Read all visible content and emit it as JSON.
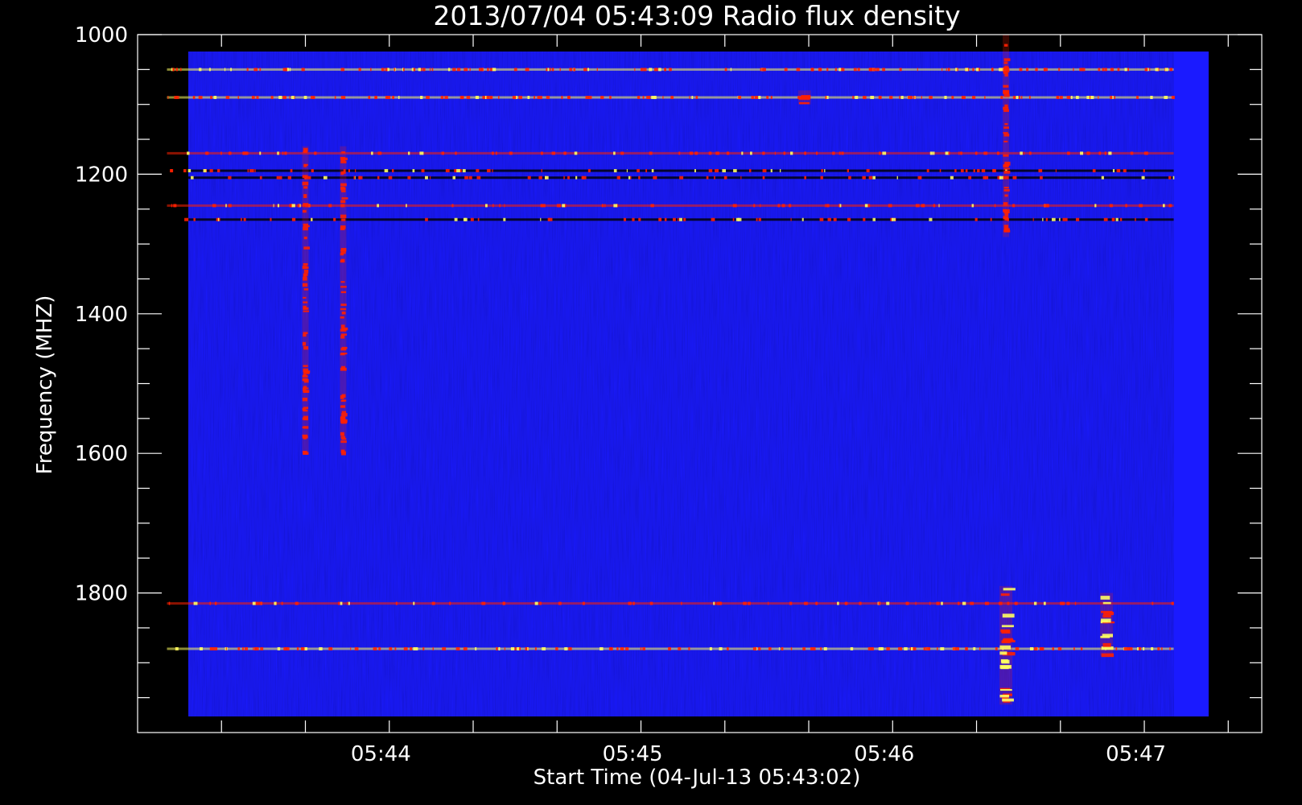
{
  "chart_data": {
    "type": "heatmap",
    "title": "2013/07/04 05:43:09 Radio flux density",
    "xlabel": "Start Time (04-Jul-13 05:43:02)",
    "ylabel": "Frequency (MHZ)",
    "y_axis_inverted": true,
    "ylim": [
      1000,
      2000
    ],
    "y_ticks": [
      1000,
      1200,
      1400,
      1600,
      1800
    ],
    "y_tick_labels": [
      "1000",
      "1200",
      "1400",
      "1600",
      "1800"
    ],
    "xlim": [
      "05:43:02",
      "05:47:30"
    ],
    "x_ticks": [
      "05:44",
      "05:45",
      "05:46",
      "05:47"
    ],
    "x_tick_labels": [
      "05:44",
      "05:45",
      "05:46",
      "05:47"
    ],
    "image_time_range": [
      "05:43:09",
      "05:47:09"
    ],
    "image_freq_range": [
      1000,
      1999
    ],
    "colormap": {
      "background": "#1a1aff",
      "low": "#000000",
      "mid": "#ff2000",
      "high": "#ffff60"
    },
    "features": [
      {
        "kind": "band",
        "freq": 1050,
        "intensity": "high"
      },
      {
        "kind": "band",
        "freq": 1090,
        "intensity": "high"
      },
      {
        "kind": "band",
        "freq": 1170,
        "intensity": "medium"
      },
      {
        "kind": "band",
        "freq": 1195,
        "intensity": "low"
      },
      {
        "kind": "band",
        "freq": 1205,
        "intensity": "low"
      },
      {
        "kind": "band",
        "freq": 1245,
        "intensity": "medium"
      },
      {
        "kind": "band",
        "freq": 1265,
        "intensity": "low"
      },
      {
        "kind": "band",
        "freq": 1815,
        "intensity": "medium"
      },
      {
        "kind": "band",
        "freq": 1880,
        "intensity": "high"
      },
      {
        "kind": "burst",
        "time": "05:46:29",
        "freq_range": [
          1790,
          1960
        ],
        "intensity": "high"
      },
      {
        "kind": "burst",
        "time": "05:46:29",
        "freq_range": [
          1000,
          1290
        ],
        "intensity": "medium"
      },
      {
        "kind": "burst",
        "time": "05:43:42",
        "freq_range": [
          1160,
          1600
        ],
        "intensity": "medium"
      },
      {
        "kind": "burst",
        "time": "05:43:51",
        "freq_range": [
          1160,
          1600
        ],
        "intensity": "medium"
      },
      {
        "kind": "burst",
        "time": "05:46:53",
        "freq_range": [
          1800,
          1890
        ],
        "intensity": "high"
      },
      {
        "kind": "burst",
        "time": "05:45:41",
        "freq_range": [
          1080,
          1100
        ],
        "intensity": "high"
      }
    ]
  }
}
